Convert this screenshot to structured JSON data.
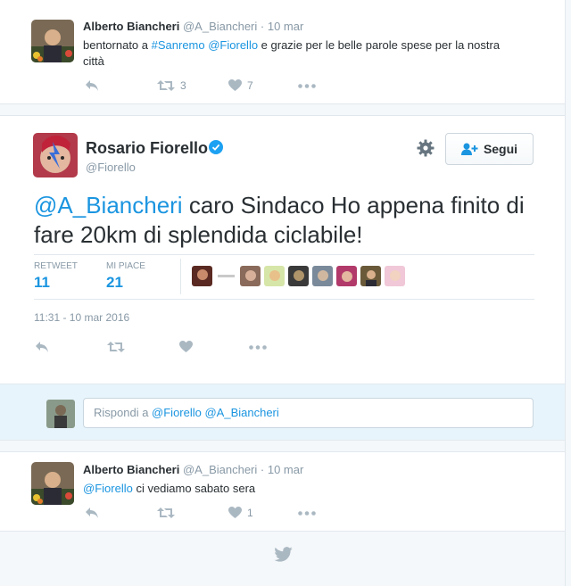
{
  "reply_above": {
    "author_name": "Alberto Biancheri",
    "author_handle": "@A_Biancheri",
    "time": "· 10 mar",
    "text_pre": "bentornato a ",
    "hashtag": "#Sanremo",
    "mention": "@Fiorello",
    "text_post_line1": " e grazie per le belle parole spese per la nostra",
    "text_post_line2": "città",
    "retweets": "3",
    "likes": "7"
  },
  "main_tweet": {
    "author_name": "Rosario Fiorello",
    "author_handle": "@Fiorello",
    "follow_label": "Segui",
    "mention": "@A_Biancheri",
    "text_line1": " caro Sindaco Ho appena finito di",
    "text_line2": "fare 20km di splendida ciclabile!",
    "stats": {
      "retweet_label": "RETWEET",
      "retweet_count": "11",
      "like_label": "MI PIACE",
      "like_count": "21"
    },
    "timestamp": "11:31 - 10 mar 2016"
  },
  "reply_box": {
    "placeholder_prefix": "Rispondi a ",
    "mentions": "@Fiorello @A_Biancheri"
  },
  "reply_below": {
    "author_name": "Alberto Biancheri",
    "author_handle": "@A_Biancheri",
    "time": "· 10 mar",
    "mention": "@Fiorello",
    "text": " ci vediamo sabato sera",
    "likes": "1"
  },
  "colors": {
    "link": "#1b95e0",
    "muted": "#8899a6",
    "verified": "#1da1f2"
  },
  "icons": [
    "reply-icon",
    "retweet-icon",
    "heart-icon",
    "more-icon",
    "gear-icon",
    "follow-user-icon",
    "verified-badge-icon",
    "twitter-bird-icon"
  ]
}
